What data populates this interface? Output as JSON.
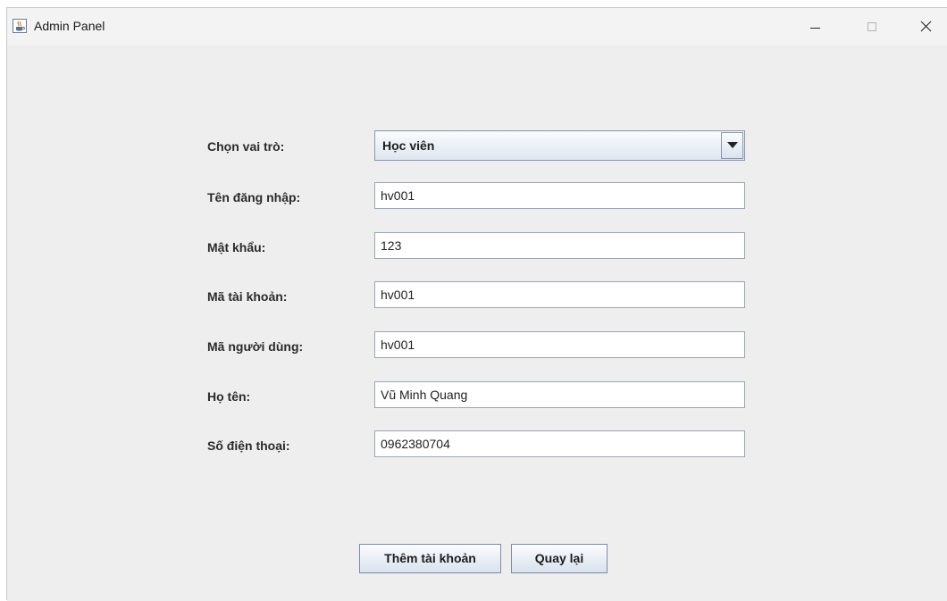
{
  "window": {
    "title": "Admin Panel",
    "icon": "java-cup-icon",
    "controls": [
      "minimize-icon",
      "maximize-icon",
      "close-icon"
    ]
  },
  "form": {
    "role": {
      "label": "Chọn vai trò:",
      "selected": "Học viên"
    },
    "username": {
      "label": "Tên đăng nhập:",
      "value": "hv001"
    },
    "password": {
      "label": "Mật khẩu:",
      "value": "123"
    },
    "account_id": {
      "label": "Mã tài khoản:",
      "value": "hv001"
    },
    "user_id": {
      "label": "Mã người dùng:",
      "value": "hv001"
    },
    "full_name": {
      "label": "Họ tên:",
      "value": "Vũ Minh Quang"
    },
    "phone": {
      "label": "Số điện thoại:",
      "value": "0962380704"
    }
  },
  "buttons": {
    "add_account": "Thêm tài khoản",
    "back": "Quay lại"
  },
  "colors": {
    "window_bg": "#eeeeee",
    "field_border": "#9aa5b4",
    "button_gradient_top": "#fbfcfe",
    "button_gradient_bottom": "#d8e2ee"
  }
}
